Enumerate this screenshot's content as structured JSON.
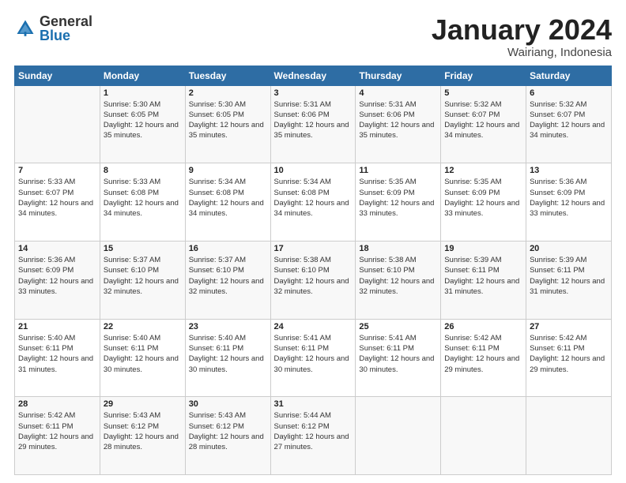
{
  "header": {
    "logo": {
      "general": "General",
      "blue": "Blue"
    },
    "title": "January 2024",
    "location": "Wairiang, Indonesia"
  },
  "days_of_week": [
    "Sunday",
    "Monday",
    "Tuesday",
    "Wednesday",
    "Thursday",
    "Friday",
    "Saturday"
  ],
  "weeks": [
    [
      {
        "day": null,
        "sunrise": null,
        "sunset": null,
        "daylight": null
      },
      {
        "day": "1",
        "sunrise": "Sunrise: 5:30 AM",
        "sunset": "Sunset: 6:05 PM",
        "daylight": "Daylight: 12 hours and 35 minutes."
      },
      {
        "day": "2",
        "sunrise": "Sunrise: 5:30 AM",
        "sunset": "Sunset: 6:05 PM",
        "daylight": "Daylight: 12 hours and 35 minutes."
      },
      {
        "day": "3",
        "sunrise": "Sunrise: 5:31 AM",
        "sunset": "Sunset: 6:06 PM",
        "daylight": "Daylight: 12 hours and 35 minutes."
      },
      {
        "day": "4",
        "sunrise": "Sunrise: 5:31 AM",
        "sunset": "Sunset: 6:06 PM",
        "daylight": "Daylight: 12 hours and 35 minutes."
      },
      {
        "day": "5",
        "sunrise": "Sunrise: 5:32 AM",
        "sunset": "Sunset: 6:07 PM",
        "daylight": "Daylight: 12 hours and 34 minutes."
      },
      {
        "day": "6",
        "sunrise": "Sunrise: 5:32 AM",
        "sunset": "Sunset: 6:07 PM",
        "daylight": "Daylight: 12 hours and 34 minutes."
      }
    ],
    [
      {
        "day": "7",
        "sunrise": "Sunrise: 5:33 AM",
        "sunset": "Sunset: 6:07 PM",
        "daylight": "Daylight: 12 hours and 34 minutes."
      },
      {
        "day": "8",
        "sunrise": "Sunrise: 5:33 AM",
        "sunset": "Sunset: 6:08 PM",
        "daylight": "Daylight: 12 hours and 34 minutes."
      },
      {
        "day": "9",
        "sunrise": "Sunrise: 5:34 AM",
        "sunset": "Sunset: 6:08 PM",
        "daylight": "Daylight: 12 hours and 34 minutes."
      },
      {
        "day": "10",
        "sunrise": "Sunrise: 5:34 AM",
        "sunset": "Sunset: 6:08 PM",
        "daylight": "Daylight: 12 hours and 34 minutes."
      },
      {
        "day": "11",
        "sunrise": "Sunrise: 5:35 AM",
        "sunset": "Sunset: 6:09 PM",
        "daylight": "Daylight: 12 hours and 33 minutes."
      },
      {
        "day": "12",
        "sunrise": "Sunrise: 5:35 AM",
        "sunset": "Sunset: 6:09 PM",
        "daylight": "Daylight: 12 hours and 33 minutes."
      },
      {
        "day": "13",
        "sunrise": "Sunrise: 5:36 AM",
        "sunset": "Sunset: 6:09 PM",
        "daylight": "Daylight: 12 hours and 33 minutes."
      }
    ],
    [
      {
        "day": "14",
        "sunrise": "Sunrise: 5:36 AM",
        "sunset": "Sunset: 6:09 PM",
        "daylight": "Daylight: 12 hours and 33 minutes."
      },
      {
        "day": "15",
        "sunrise": "Sunrise: 5:37 AM",
        "sunset": "Sunset: 6:10 PM",
        "daylight": "Daylight: 12 hours and 32 minutes."
      },
      {
        "day": "16",
        "sunrise": "Sunrise: 5:37 AM",
        "sunset": "Sunset: 6:10 PM",
        "daylight": "Daylight: 12 hours and 32 minutes."
      },
      {
        "day": "17",
        "sunrise": "Sunrise: 5:38 AM",
        "sunset": "Sunset: 6:10 PM",
        "daylight": "Daylight: 12 hours and 32 minutes."
      },
      {
        "day": "18",
        "sunrise": "Sunrise: 5:38 AM",
        "sunset": "Sunset: 6:10 PM",
        "daylight": "Daylight: 12 hours and 32 minutes."
      },
      {
        "day": "19",
        "sunrise": "Sunrise: 5:39 AM",
        "sunset": "Sunset: 6:11 PM",
        "daylight": "Daylight: 12 hours and 31 minutes."
      },
      {
        "day": "20",
        "sunrise": "Sunrise: 5:39 AM",
        "sunset": "Sunset: 6:11 PM",
        "daylight": "Daylight: 12 hours and 31 minutes."
      }
    ],
    [
      {
        "day": "21",
        "sunrise": "Sunrise: 5:40 AM",
        "sunset": "Sunset: 6:11 PM",
        "daylight": "Daylight: 12 hours and 31 minutes."
      },
      {
        "day": "22",
        "sunrise": "Sunrise: 5:40 AM",
        "sunset": "Sunset: 6:11 PM",
        "daylight": "Daylight: 12 hours and 30 minutes."
      },
      {
        "day": "23",
        "sunrise": "Sunrise: 5:40 AM",
        "sunset": "Sunset: 6:11 PM",
        "daylight": "Daylight: 12 hours and 30 minutes."
      },
      {
        "day": "24",
        "sunrise": "Sunrise: 5:41 AM",
        "sunset": "Sunset: 6:11 PM",
        "daylight": "Daylight: 12 hours and 30 minutes."
      },
      {
        "day": "25",
        "sunrise": "Sunrise: 5:41 AM",
        "sunset": "Sunset: 6:11 PM",
        "daylight": "Daylight: 12 hours and 30 minutes."
      },
      {
        "day": "26",
        "sunrise": "Sunrise: 5:42 AM",
        "sunset": "Sunset: 6:11 PM",
        "daylight": "Daylight: 12 hours and 29 minutes."
      },
      {
        "day": "27",
        "sunrise": "Sunrise: 5:42 AM",
        "sunset": "Sunset: 6:11 PM",
        "daylight": "Daylight: 12 hours and 29 minutes."
      }
    ],
    [
      {
        "day": "28",
        "sunrise": "Sunrise: 5:42 AM",
        "sunset": "Sunset: 6:11 PM",
        "daylight": "Daylight: 12 hours and 29 minutes."
      },
      {
        "day": "29",
        "sunrise": "Sunrise: 5:43 AM",
        "sunset": "Sunset: 6:12 PM",
        "daylight": "Daylight: 12 hours and 28 minutes."
      },
      {
        "day": "30",
        "sunrise": "Sunrise: 5:43 AM",
        "sunset": "Sunset: 6:12 PM",
        "daylight": "Daylight: 12 hours and 28 minutes."
      },
      {
        "day": "31",
        "sunrise": "Sunrise: 5:44 AM",
        "sunset": "Sunset: 6:12 PM",
        "daylight": "Daylight: 12 hours and 27 minutes."
      },
      {
        "day": null,
        "sunrise": null,
        "sunset": null,
        "daylight": null
      },
      {
        "day": null,
        "sunrise": null,
        "sunset": null,
        "daylight": null
      },
      {
        "day": null,
        "sunrise": null,
        "sunset": null,
        "daylight": null
      }
    ]
  ]
}
